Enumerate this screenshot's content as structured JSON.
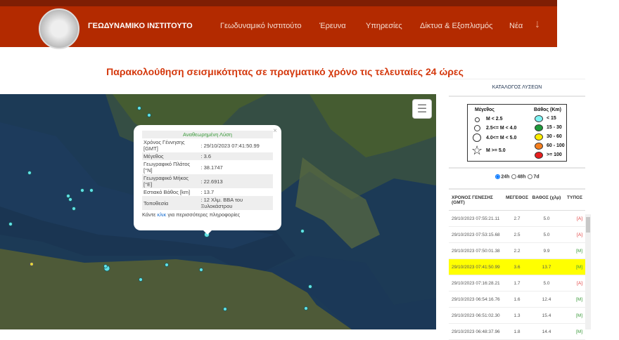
{
  "header": {
    "brand": "ΓΕΩΔΥΝΑΜΙΚΟ ΙΝΣΤΙΤΟΥΤΟ",
    "nav": [
      "Γεωδυναμικό Ινστιτούτο",
      "Έρευνα",
      "Υπηρεσίες",
      "Δίκτυα & Εξοπλισμός",
      "Νέα"
    ],
    "arrow": "↓"
  },
  "page_title": "Παρακολούθηση σεισμικότητας σε πραγματικό χρόνο τις τελευταίες 24 ώρες",
  "map": {
    "layers_icon": "layers-icon",
    "popup": {
      "close": "×",
      "heading": "Αναθεωρημένη Λύση",
      "rows": [
        {
          "label": "Χρόνος Γέννησης [GMT]",
          "value": ": 29/10/2023 07:41:50.99"
        },
        {
          "label": "Μέγεθος",
          "value": ": 3.6"
        },
        {
          "label": "Γεωγραφικό Πλάτος [°N]",
          "value": ": 38.1747"
        },
        {
          "label": "Γεωγραφικό Μήκος [°E]",
          "value": ": 22.6913"
        },
        {
          "label": "Εστιακό Βάθος [km]",
          "value": ": 13.7"
        },
        {
          "label": "Τοποθεσία",
          "value": ": 12 Χλμ. ΒΒΑ του Ξυλοκάστρου"
        }
      ],
      "more_pre": "Κάντε ",
      "more_link": "κλικ",
      "more_post": " για περισσότερες πληροφορίες"
    }
  },
  "sidebar": {
    "catalog_title": "ΚΑΤΑΛΟΓΟΣ ΛΥΣΕΩΝ",
    "legend": {
      "size_title": "Μέγεθος",
      "sizes": [
        "M < 2.5",
        "2.5<= M < 4.0",
        "4.0<= M < 5.0",
        "M >= 5.0"
      ],
      "depth_title": "Βάθος (Km)",
      "depths": [
        {
          "label": "< 15",
          "color": "#7ff5f5"
        },
        {
          "label": "15 - 30",
          "color": "#1e9a3a"
        },
        {
          "label": "30 - 60",
          "color": "#ffee00"
        },
        {
          "label": "60 - 100",
          "color": "#f57f1e"
        },
        {
          "label": ">= 100",
          "color": "#e61e1e"
        }
      ]
    },
    "ranges": [
      "24h",
      "48h",
      "7d"
    ],
    "selected_range": "24h"
  },
  "table": {
    "headers": [
      "ΧΡΟΝΟΣ ΓΕΝΕΣΗΣ (GMT)",
      "ΜΕΓΕΘΟΣ",
      "ΒΑΘΟΣ (χλμ)",
      "ΤΥΠΟΣ"
    ],
    "rows": [
      [
        "29/10/2023 07:55:21.11",
        "2.7",
        "5.0",
        "[A]"
      ],
      [
        "29/10/2023 07:53:15.68",
        "2.5",
        "5.0",
        "[A]"
      ],
      [
        "29/10/2023 07:50:01.38",
        "2.2",
        "9.9",
        "[M]"
      ],
      [
        "29/10/2023 07:41:50.99",
        "3.6",
        "13.7",
        "[M]"
      ],
      [
        "29/10/2023 07:16:28.21",
        "1.7",
        "5.0",
        "[A]"
      ],
      [
        "29/10/2023 06:54:16.76",
        "1.6",
        "12.4",
        "[M]"
      ],
      [
        "29/10/2023 06:51:02.30",
        "1.3",
        "15.4",
        "[M]"
      ],
      [
        "29/10/2023 06:48:37.96",
        "1.8",
        "14.4",
        "[M]"
      ]
    ],
    "highlighted_row": 3
  }
}
